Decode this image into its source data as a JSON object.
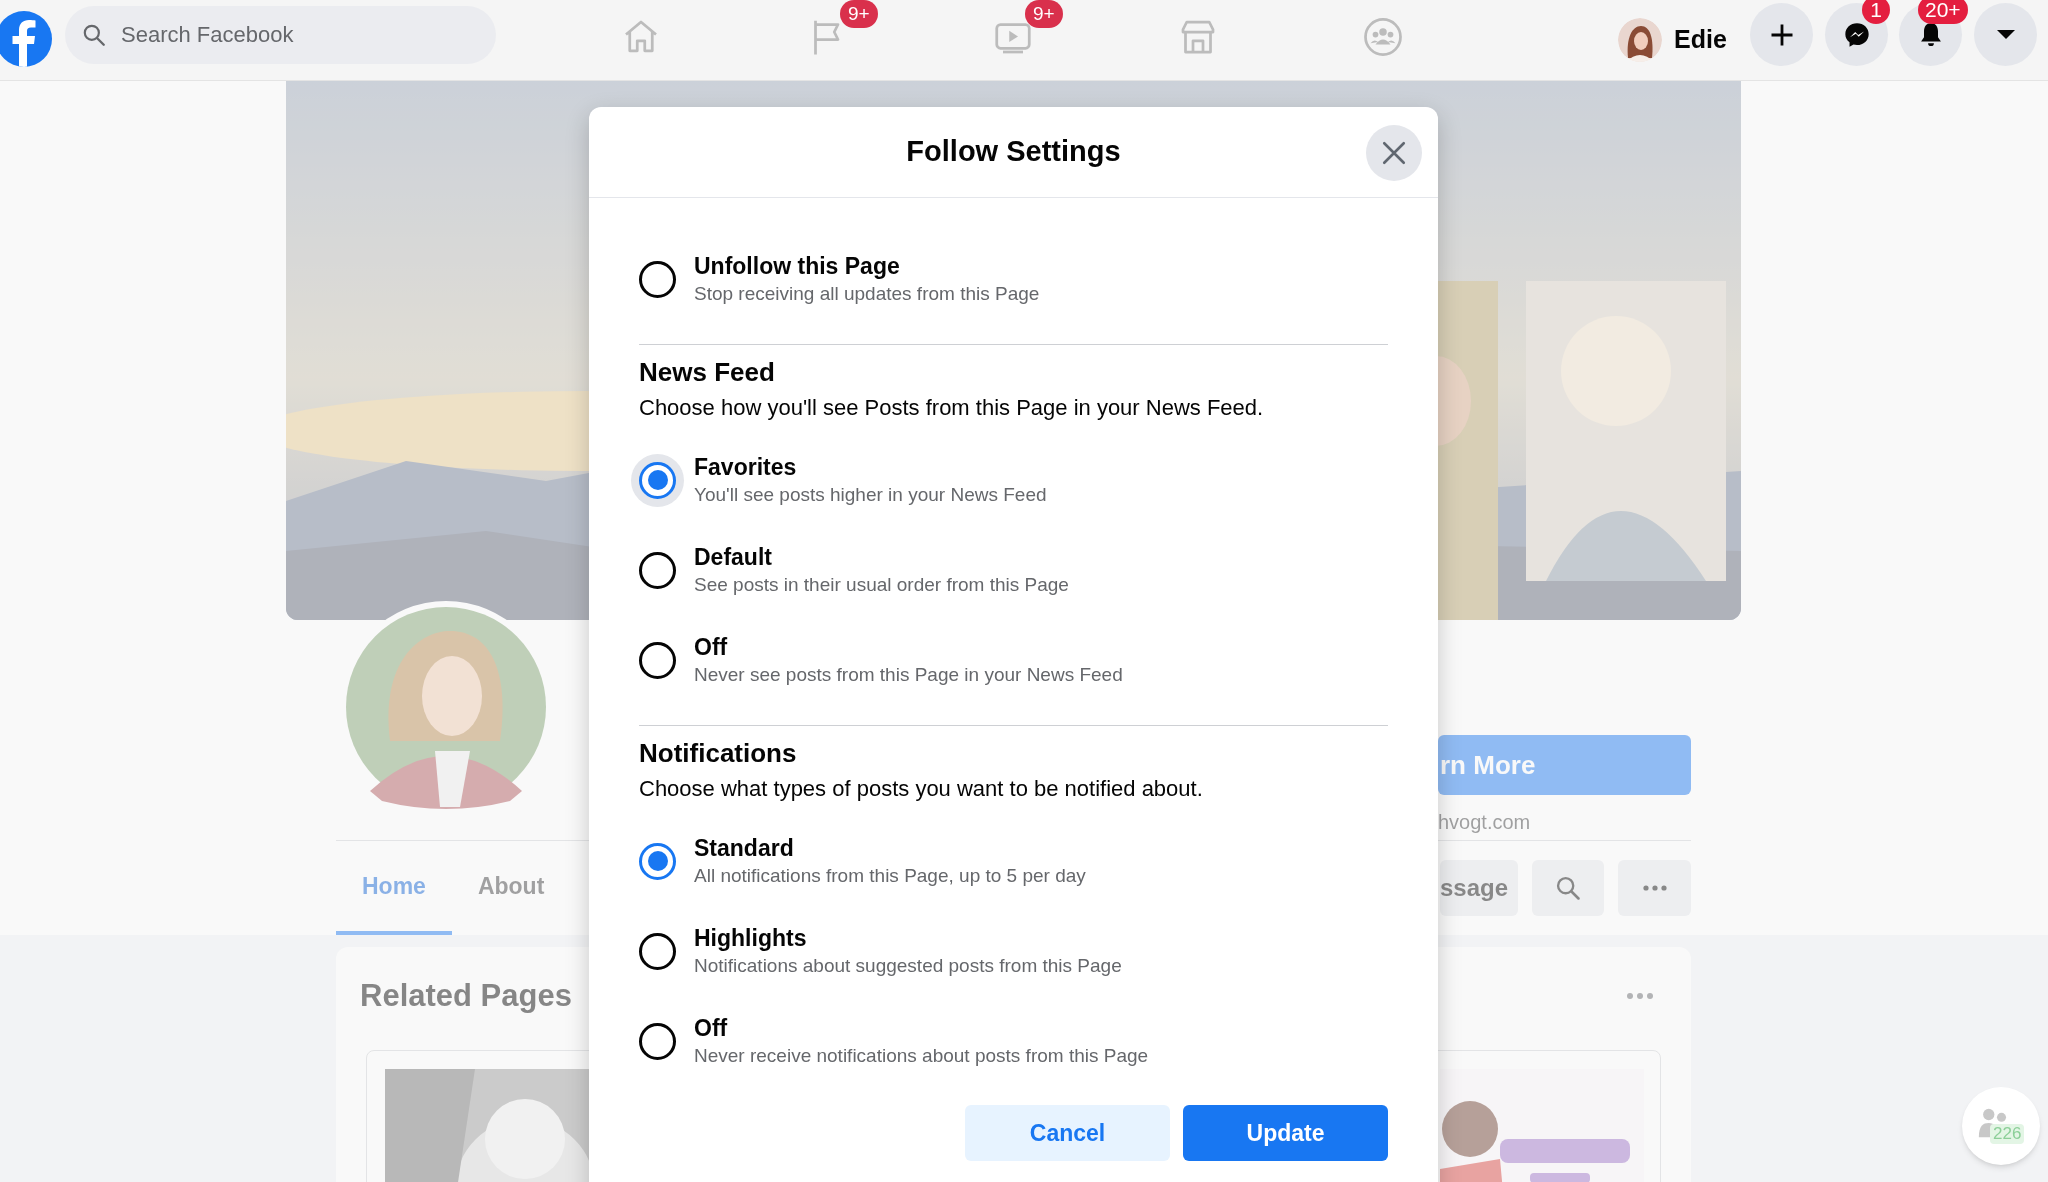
{
  "topbar": {
    "search_placeholder": "Search Facebook",
    "nav": [
      {
        "kind": "home"
      },
      {
        "kind": "flag",
        "badge": "9+"
      },
      {
        "kind": "video",
        "badge": "9+"
      },
      {
        "kind": "store"
      },
      {
        "kind": "groups"
      }
    ],
    "user": {
      "name": "Edie"
    },
    "buttons": [
      {
        "kind": "plus"
      },
      {
        "kind": "messenger",
        "badge": "1"
      },
      {
        "kind": "bell",
        "badge": "20+"
      },
      {
        "kind": "caret"
      }
    ]
  },
  "page": {
    "cta": "rn More",
    "website": "hvogt.com",
    "message_button": "ssage",
    "tabs": [
      {
        "label": "Home",
        "selected": true
      },
      {
        "label": "About",
        "selected": false
      }
    ],
    "related_title": "Related Pages",
    "contacts_count": "226"
  },
  "dialog": {
    "title": "Follow Settings",
    "groups": [
      {
        "options": [
          {
            "label": "Unfollow this Page",
            "description": "Stop receiving all updates from this Page",
            "selected": false,
            "hovered": false
          }
        ]
      },
      {
        "heading": "News Feed",
        "description": "Choose how you'll see Posts from this Page in your News Feed.",
        "options": [
          {
            "label": "Favorites",
            "description": "You'll see posts higher in your News Feed",
            "selected": true,
            "hovered": true
          },
          {
            "label": "Default",
            "description": "See posts in their usual order from this Page",
            "selected": false,
            "hovered": false
          },
          {
            "label": "Off",
            "description": "Never see posts from this Page in your News Feed",
            "selected": false,
            "hovered": false
          }
        ]
      },
      {
        "heading": "Notifications",
        "description": "Choose what types of posts you want to be notified about.",
        "options": [
          {
            "label": "Standard",
            "description": "All notifications from this Page, up to 5 per day",
            "selected": true,
            "hovered": false
          },
          {
            "label": "Highlights",
            "description": "Notifications about suggested posts from this Page",
            "selected": false,
            "hovered": false
          },
          {
            "label": "Off",
            "description": "Never receive notifications about posts from this Page",
            "selected": false,
            "hovered": false
          }
        ]
      }
    ],
    "cancel": "Cancel",
    "update": "Update"
  }
}
